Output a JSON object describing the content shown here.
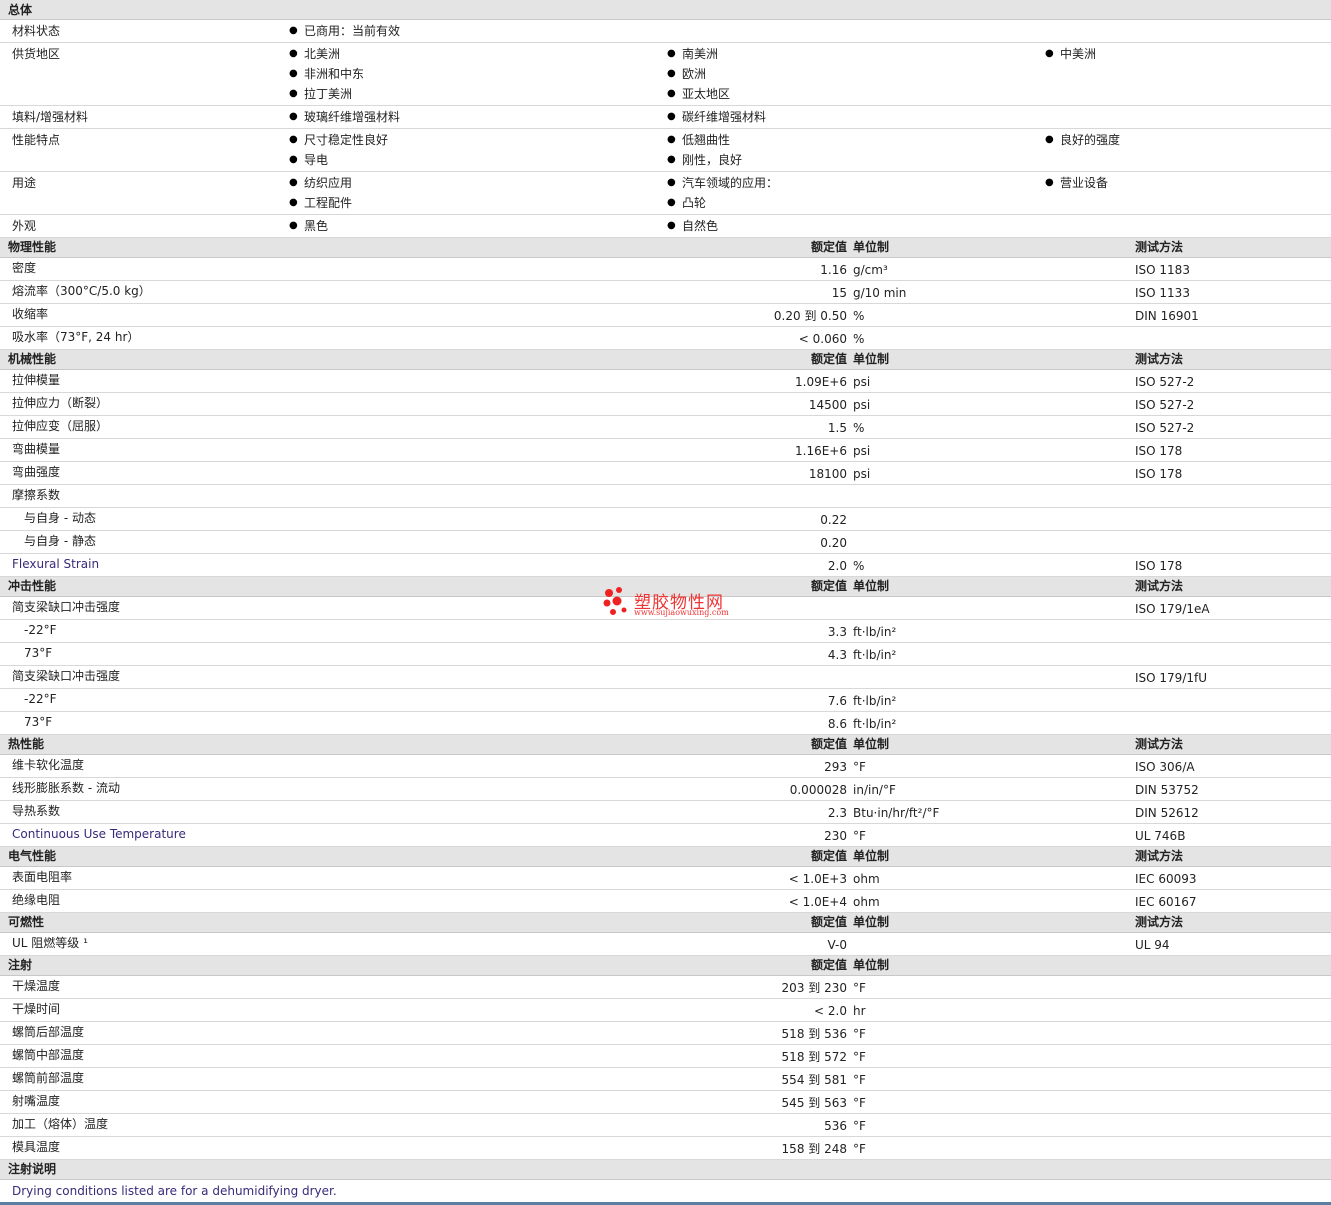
{
  "general": {
    "title": "总体",
    "rows": [
      {
        "label": "材料状态",
        "cols": [
          [
            "已商用：当前有效"
          ],
          [],
          []
        ]
      },
      {
        "label": "供货地区",
        "cols": [
          [
            "北美洲",
            "非洲和中东",
            "拉丁美洲"
          ],
          [
            "南美洲",
            "欧洲",
            "亚太地区"
          ],
          [
            "中美洲"
          ]
        ]
      },
      {
        "label": "填料/增强材料",
        "cols": [
          [
            "玻璃纤维增强材料"
          ],
          [
            "碳纤维增强材料"
          ],
          []
        ]
      },
      {
        "label": "性能特点",
        "cols": [
          [
            "尺寸稳定性良好",
            "导电"
          ],
          [
            "低翘曲性",
            "刚性，良好"
          ],
          [
            "良好的强度"
          ]
        ]
      },
      {
        "label": "用途",
        "cols": [
          [
            "纺织应用",
            "工程配件"
          ],
          [
            "汽车领域的应用：",
            "凸轮"
          ],
          [
            "营业设备"
          ]
        ]
      },
      {
        "label": "外观",
        "cols": [
          [
            "黑色"
          ],
          [
            "自然色"
          ],
          []
        ]
      }
    ]
  },
  "headers": {
    "value": "额定值",
    "unit": "单位制",
    "test": "测试方法"
  },
  "sections": [
    {
      "title": "物理性能",
      "show_test": true,
      "rows": [
        {
          "label": "密度",
          "value": "1.16",
          "unit": "g/cm³",
          "test": "ISO 1183"
        },
        {
          "label": "熔流率（300°C/5.0 kg）",
          "value": "15",
          "unit": "g/10 min",
          "test": "ISO 1133"
        },
        {
          "label": "收缩率",
          "value": "0.20 到 0.50",
          "unit": "%",
          "test": "DIN 16901"
        },
        {
          "label": "吸水率（73°F, 24 hr）",
          "value": "< 0.060",
          "unit": "%",
          "test": ""
        }
      ]
    },
    {
      "title": "机械性能",
      "show_test": true,
      "rows": [
        {
          "label": "拉伸模量",
          "value": "1.09E+6",
          "unit": "psi",
          "test": "ISO 527-2"
        },
        {
          "label": "拉伸应力（断裂）",
          "value": "14500",
          "unit": "psi",
          "test": "ISO 527-2"
        },
        {
          "label": "拉伸应变（屈服）",
          "value": "1.5",
          "unit": "%",
          "test": "ISO 527-2"
        },
        {
          "label": "弯曲模量",
          "value": "1.16E+6",
          "unit": "psi",
          "test": "ISO 178"
        },
        {
          "label": "弯曲强度",
          "value": "18100",
          "unit": "psi",
          "test": "ISO 178"
        },
        {
          "label": "摩擦系数",
          "value": "",
          "unit": "",
          "test": ""
        },
        {
          "label": "与自身 - 动态",
          "indent": true,
          "value": "0.22",
          "unit": "",
          "test": ""
        },
        {
          "label": "与自身 - 静态",
          "indent": true,
          "value": "0.20",
          "unit": "",
          "test": ""
        },
        {
          "label": "Flexural Strain",
          "link": true,
          "value": "2.0",
          "unit": "%",
          "test": "ISO 178"
        }
      ]
    },
    {
      "title": "冲击性能",
      "show_test": true,
      "rows": [
        {
          "label": "简支梁缺口冲击强度",
          "value": "",
          "unit": "",
          "test": "ISO 179/1eA"
        },
        {
          "label": "-22°F",
          "indent": true,
          "value": "3.3",
          "unit": "ft·lb/in²",
          "test": ""
        },
        {
          "label": "73°F",
          "indent": true,
          "value": "4.3",
          "unit": "ft·lb/in²",
          "test": ""
        },
        {
          "label": "简支梁缺口冲击强度",
          "value": "",
          "unit": "",
          "test": "ISO 179/1fU"
        },
        {
          "label": "-22°F",
          "indent": true,
          "value": "7.6",
          "unit": "ft·lb/in²",
          "test": ""
        },
        {
          "label": "73°F",
          "indent": true,
          "value": "8.6",
          "unit": "ft·lb/in²",
          "test": ""
        }
      ]
    },
    {
      "title": "热性能",
      "show_test": true,
      "rows": [
        {
          "label": "维卡软化温度",
          "value": "293",
          "unit": "°F",
          "test": "ISO 306/A"
        },
        {
          "label": "线形膨胀系数 - 流动",
          "value": "0.000028",
          "unit": "in/in/°F",
          "test": "DIN 53752"
        },
        {
          "label": "导热系数",
          "value": "2.3",
          "unit": "Btu·in/hr/ft²/°F",
          "test": "DIN 52612"
        },
        {
          "label": "Continuous Use Temperature",
          "link": true,
          "value": "230",
          "unit": "°F",
          "test": "UL 746B"
        }
      ]
    },
    {
      "title": "电气性能",
      "show_test": true,
      "rows": [
        {
          "label": "表面电阻率",
          "value": "< 1.0E+3",
          "unit": "ohm",
          "test": "IEC 60093"
        },
        {
          "label": "绝缘电阻",
          "value": "< 1.0E+4",
          "unit": "ohm",
          "test": "IEC 60167"
        }
      ]
    },
    {
      "title": "可燃性",
      "show_test": true,
      "rows": [
        {
          "label": "UL 阻燃等级 ¹",
          "value": "V-0",
          "unit": "",
          "test": "UL 94"
        }
      ]
    },
    {
      "title": "注射",
      "show_test": false,
      "rows": [
        {
          "label": "干燥温度",
          "value": "203 到 230",
          "unit": "°F",
          "test": ""
        },
        {
          "label": "干燥时间",
          "value": "< 2.0",
          "unit": "hr",
          "test": ""
        },
        {
          "label": "螺筒后部温度",
          "value": "518 到 536",
          "unit": "°F",
          "test": ""
        },
        {
          "label": "螺筒中部温度",
          "value": "518 到 572",
          "unit": "°F",
          "test": ""
        },
        {
          "label": "螺筒前部温度",
          "value": "554 到 581",
          "unit": "°F",
          "test": ""
        },
        {
          "label": "射嘴温度",
          "value": "545 到 563",
          "unit": "°F",
          "test": ""
        },
        {
          "label": "加工（熔体）温度",
          "value": "536",
          "unit": "°F",
          "test": ""
        },
        {
          "label": "模具温度",
          "value": "158 到 248",
          "unit": "°F",
          "test": ""
        }
      ]
    }
  ],
  "notes": {
    "title": "注射说明",
    "text": "Drying conditions listed are for a dehumidifying dryer."
  },
  "watermark": {
    "text": "塑胶物性网",
    "url": "www.sujiaowuxing.com"
  }
}
